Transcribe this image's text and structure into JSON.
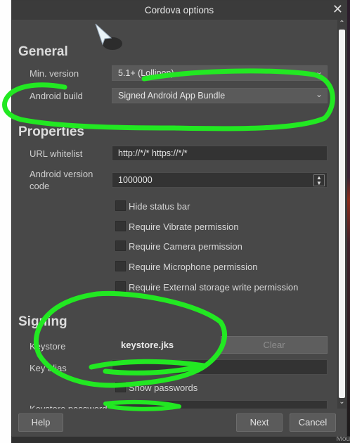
{
  "dialog": {
    "title": "Cordova options",
    "close_glyph": "✕"
  },
  "general": {
    "heading": "General",
    "min_version": {
      "label": "Min. version",
      "value": "5.1+ (Lollipop)"
    },
    "android_build": {
      "label": "Android build",
      "value": "Signed Android App Bundle"
    }
  },
  "properties": {
    "heading": "Properties",
    "url_whitelist": {
      "label": "URL whitelist",
      "value": "http://*/* https://*/*"
    },
    "version_code": {
      "label": "Android version code",
      "value": "1000000"
    },
    "checkboxes": [
      {
        "label": "Hide status bar",
        "checked": false
      },
      {
        "label": "Require Vibrate permission",
        "checked": false
      },
      {
        "label": "Require Camera permission",
        "checked": false
      },
      {
        "label": "Require Microphone permission",
        "checked": false
      },
      {
        "label": "Require External storage write permission",
        "checked": false
      }
    ]
  },
  "signing": {
    "heading": "Signing",
    "keystore": {
      "label": "Keystore",
      "value": "keystore.jks",
      "clear_label": "Clear"
    },
    "key_alias": {
      "label": "Key alias",
      "value": ""
    },
    "show_passwords": {
      "label": "Show passwords",
      "checked": false
    },
    "keystore_password": {
      "label": "Keystore password",
      "value": ""
    }
  },
  "footer": {
    "help": "Help",
    "next": "Next",
    "cancel": "Cancel"
  },
  "background": {
    "partial_text": "Mou"
  },
  "annotation": {
    "stroke_color": "#22e822"
  }
}
